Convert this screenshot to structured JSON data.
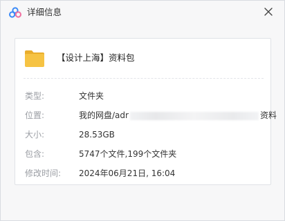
{
  "window": {
    "title": "详细信息",
    "app_icon": "cloud-logo-icon",
    "close_icon": "close-icon"
  },
  "file": {
    "name": "【设计上海】资料包",
    "icon": "folder-icon"
  },
  "details": {
    "type_label": "类型:",
    "type_value": "文件夹",
    "location_label": "位置:",
    "location_prefix": "我的网盘/adr",
    "location_suffix": "资料",
    "size_label": "大小:",
    "size_value": "28.53GB",
    "contains_label": "包含:",
    "contains_value": "5747个文件,199个文件夹",
    "modified_label": "修改时间:",
    "modified_value": "2024年06月21日, 16:04"
  },
  "colors": {
    "folder": "#f6c343",
    "logo_blue": "#3a8af7",
    "logo_pink": "#f06fa0"
  }
}
